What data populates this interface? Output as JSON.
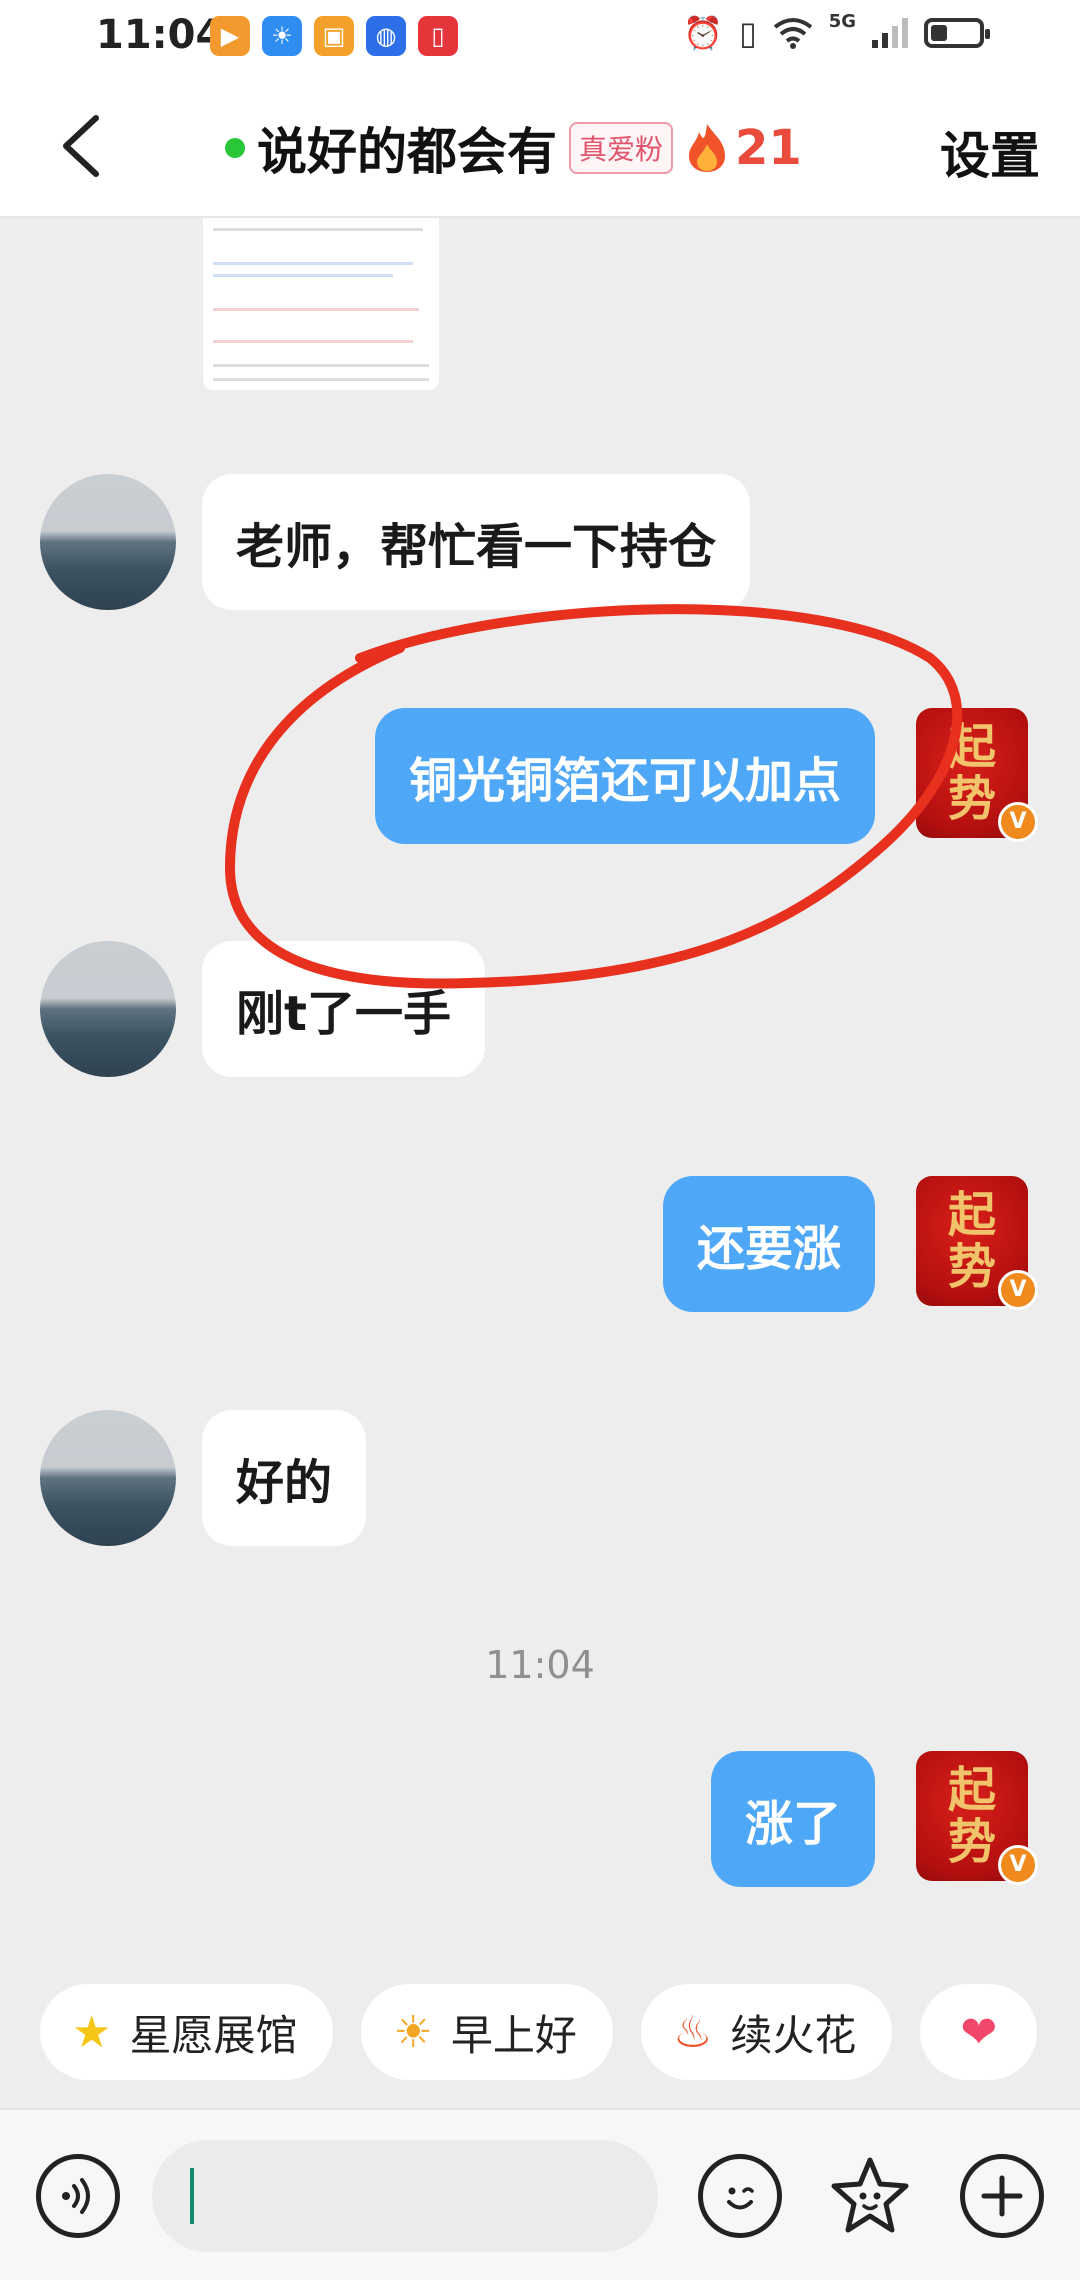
{
  "status_bar": {
    "time": "11:04",
    "network": "5G",
    "app_icons": [
      "video-app-icon",
      "weather-app-icon",
      "wallet-app-icon",
      "bulb-app-icon",
      "red-app-icon"
    ],
    "battery_level": 0.35
  },
  "header": {
    "title": "说好的都会有",
    "badge": "真爱粉",
    "streak_count": "21",
    "settings_label": "设置"
  },
  "messages": [
    {
      "side": "in",
      "text": "老师，帮忙看一下持仓"
    },
    {
      "side": "out",
      "text": "铜光铜箔还可以加点"
    },
    {
      "side": "in",
      "text": "刚t了一手"
    },
    {
      "side": "out",
      "text": "还要涨"
    },
    {
      "side": "in",
      "text": "好的"
    },
    {
      "side": "out",
      "text": "涨了"
    }
  ],
  "timestamp": "11:04",
  "brand_avatar": {
    "top": "起",
    "bottom": "势",
    "verified": "V"
  },
  "quick_replies": [
    {
      "icon": "star-icon",
      "label": "星愿展馆"
    },
    {
      "icon": "sun-face-icon",
      "label": "早上好"
    },
    {
      "icon": "fire-icon",
      "label": "续火花"
    },
    {
      "icon": "heart-icon",
      "label": ""
    }
  ],
  "input": {
    "placeholder": ""
  },
  "colors": {
    "outgoing_bubble": "#4fa7f7",
    "incoming_bubble": "#ffffff",
    "annotation_circle": "#e8301f",
    "online_dot": "#29c63a"
  }
}
